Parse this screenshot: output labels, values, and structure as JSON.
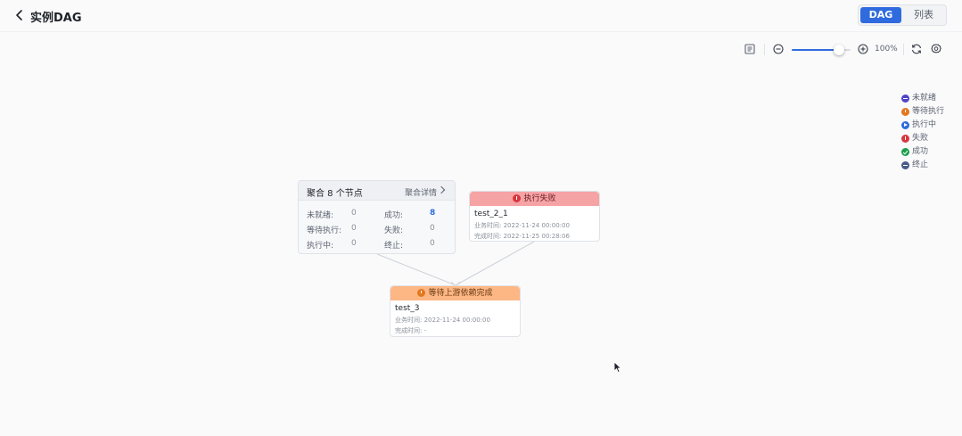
{
  "header": {
    "title": "实例DAG",
    "views": [
      "DAG",
      "列表"
    ],
    "active_view": "DAG"
  },
  "toolbar": {
    "zoom_percent": 100,
    "zoom_label": "100%",
    "zoom_slider_level": 0.8
  },
  "legend": [
    {
      "label": "未就绪",
      "color": "#4f46c8",
      "icon": "dash-icon"
    },
    {
      "label": "等待执行",
      "color": "#e3781f",
      "icon": "clock-icon"
    },
    {
      "label": "执行中",
      "color": "#2f6bde",
      "icon": "play-icon"
    },
    {
      "label": "失败",
      "color": "#d9363e",
      "icon": "exclamation-icon"
    },
    {
      "label": "成功",
      "color": "#1a9f4b",
      "icon": "check-icon"
    },
    {
      "label": "终止",
      "color": "#4b5a86",
      "icon": "stop-icon"
    }
  ],
  "aggregate": {
    "title": "聚合 8 个节点",
    "detail_link": "聚合详情",
    "stats": [
      {
        "label": "未就绪:",
        "value": "0"
      },
      {
        "label": "成功:",
        "value": "8"
      },
      {
        "label": "等待执行:",
        "value": "0"
      },
      {
        "label": "失败:",
        "value": "0"
      },
      {
        "label": "执行中:",
        "value": "0"
      },
      {
        "label": "终止:",
        "value": "0"
      }
    ]
  },
  "nodes": {
    "failed": {
      "status": "执行失败",
      "name": "test_2_1",
      "business_time": "业务时间:  2022-11-24 00:00:00",
      "finish_time": "完成时间:  2022-11-25 00:28:06"
    },
    "waiting": {
      "status": "等待上游依赖完成",
      "name": "test_3",
      "business_time": "业务时间:  2022-11-24 00:00:00",
      "finish_time": "完成时间:  -"
    }
  },
  "colors": {
    "accent": "#2f6bde",
    "failed_header": "#f6a3a6",
    "waiting_header": "#fdb785",
    "edge": "#cfd3d9"
  }
}
